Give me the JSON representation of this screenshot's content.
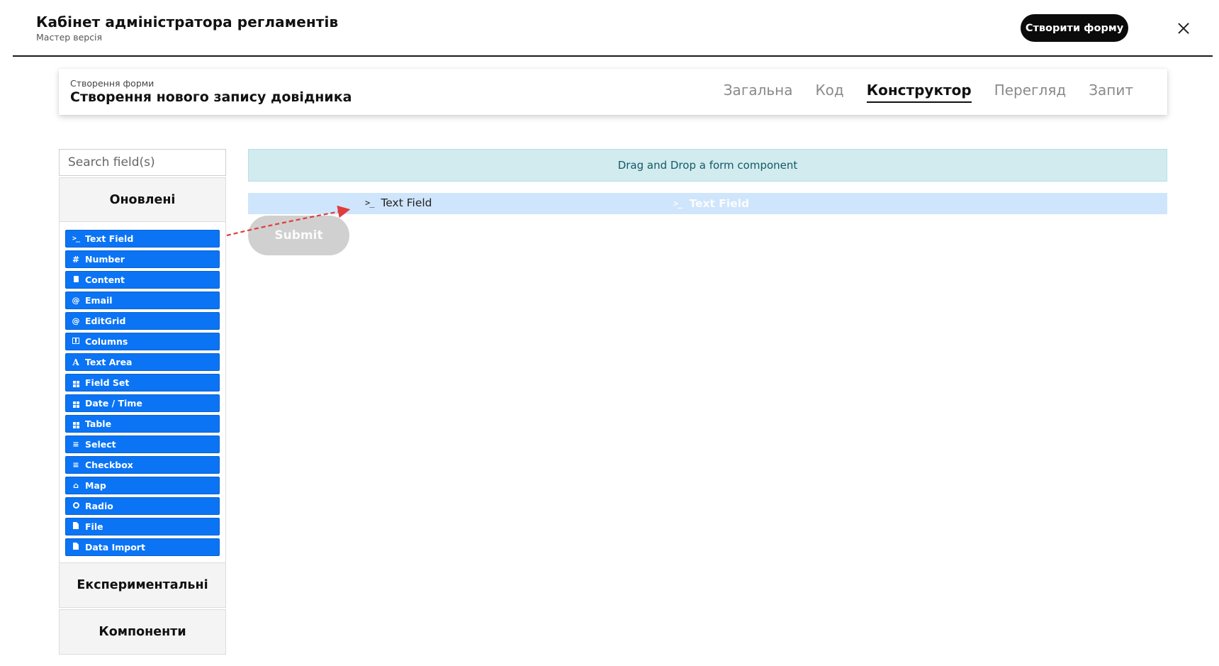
{
  "header": {
    "title": "Кабінет адміністратора регламентів",
    "subtitle": "Мастер версія",
    "create_button": "Створити форму"
  },
  "form": {
    "breadcrumb": "Створення форми",
    "name": "Створення нового запису довідника",
    "tabs": [
      {
        "label": "Загальна",
        "active": false
      },
      {
        "label": "Код",
        "active": false
      },
      {
        "label": "Конструктор",
        "active": true
      },
      {
        "label": "Перегляд",
        "active": false
      },
      {
        "label": "Запит",
        "active": false
      }
    ]
  },
  "sidebar": {
    "search_placeholder": "Search field(s)",
    "groups": {
      "updated": "Оновлені",
      "experimental": "Експериментальні",
      "components": "Компоненти"
    },
    "components": [
      {
        "label": "Text Field",
        "icon": "terminal-icon"
      },
      {
        "label": "Number",
        "icon": "hash-icon"
      },
      {
        "label": "Content",
        "icon": "content-icon"
      },
      {
        "label": "Email",
        "icon": "at-icon"
      },
      {
        "label": "EditGrid",
        "icon": "at-icon"
      },
      {
        "label": "Columns",
        "icon": "columns-icon"
      },
      {
        "label": "Text Area",
        "icon": "font-icon"
      },
      {
        "label": "Field Set",
        "icon": "grid-icon"
      },
      {
        "label": "Date / Time",
        "icon": "calendar-icon"
      },
      {
        "label": "Table",
        "icon": "table-icon"
      },
      {
        "label": "Select",
        "icon": "list-icon"
      },
      {
        "label": "Checkbox",
        "icon": "list-icon"
      },
      {
        "label": "Map",
        "icon": "home-icon"
      },
      {
        "label": "Radio",
        "icon": "radio-icon"
      },
      {
        "label": "File",
        "icon": "file-icon"
      },
      {
        "label": "Data Import",
        "icon": "file-icon"
      }
    ]
  },
  "builder": {
    "dropzone_text": "Drag and Drop a form component",
    "drag_source_label": "Text Field",
    "drag_ghost_label": "Text Field",
    "submit_label": "Submit"
  },
  "colors": {
    "component_button": "#0b74f5",
    "dropzone_bg": "#d1ebef",
    "drag_row_bg": "#cfe5fb",
    "drag_arrow": "#e03c3c",
    "primary_dark": "#0b0b0b"
  }
}
